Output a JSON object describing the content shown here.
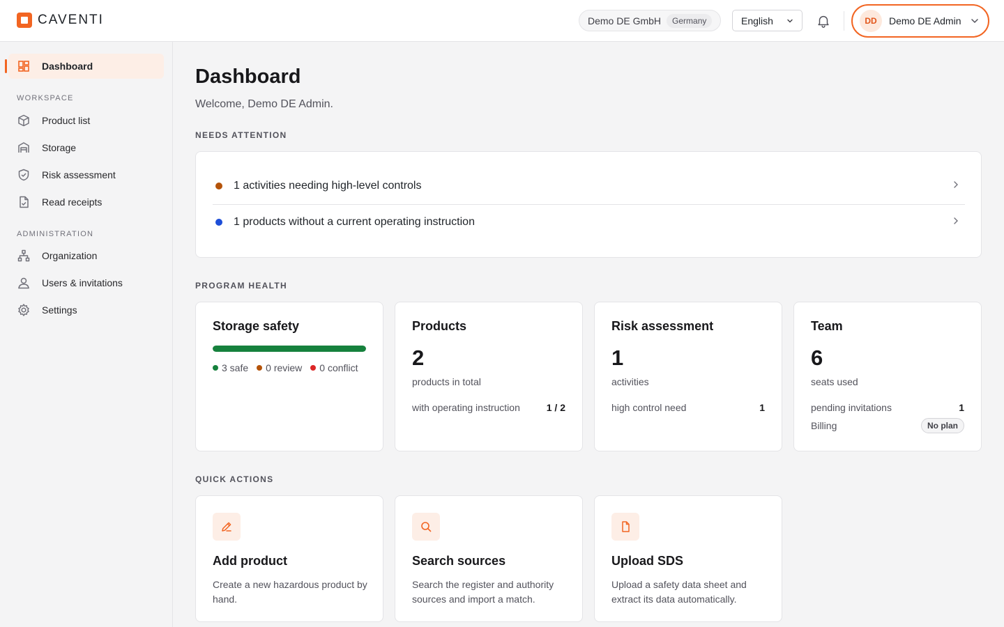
{
  "brand": {
    "name": "CAVENTI",
    "accent": "#f26522"
  },
  "header": {
    "org_name": "Demo DE GmbH",
    "org_country": "Germany",
    "language": "English",
    "user_initials": "DD",
    "user_name": "Demo DE Admin"
  },
  "sidebar": {
    "dashboard": "Dashboard",
    "workspace_label": "WORKSPACE",
    "workspace_items": [
      {
        "label": "Product list",
        "icon": "cube-icon"
      },
      {
        "label": "Storage",
        "icon": "warehouse-icon"
      },
      {
        "label": "Risk assessment",
        "icon": "shield-check-icon"
      },
      {
        "label": "Read receipts",
        "icon": "document-check-icon"
      }
    ],
    "admin_label": "ADMINISTRATION",
    "admin_items": [
      {
        "label": "Organization",
        "icon": "org-chart-icon"
      },
      {
        "label": "Users & invitations",
        "icon": "user-icon"
      },
      {
        "label": "Settings",
        "icon": "gear-icon"
      }
    ]
  },
  "main": {
    "title": "Dashboard",
    "welcome": "Welcome, Demo DE Admin.",
    "needs_attention_label": "NEEDS ATTENTION",
    "attention": [
      {
        "text": "1 activities needing high-level controls",
        "color": "#b45309"
      },
      {
        "text": "1 products without a current operating instruction",
        "color": "#1d4ed8"
      }
    ],
    "program_health_label": "PROGRAM HEALTH",
    "storage": {
      "title": "Storage safety",
      "safe_fraction": 1.0,
      "safe": "3 safe",
      "review": "0 review",
      "conflict": "0 conflict",
      "colors": {
        "safe": "#16813d",
        "review": "#b45309",
        "conflict": "#dc2626"
      }
    },
    "products": {
      "title": "Products",
      "count": "2",
      "sub": "products in total",
      "row_label": "with operating instruction",
      "row_value": "1 / 2"
    },
    "risk": {
      "title": "Risk assessment",
      "count": "1",
      "sub": "activities",
      "row_label": "high control need",
      "row_value": "1"
    },
    "team": {
      "title": "Team",
      "count": "6",
      "sub": "seats used",
      "row1_label": "pending invitations",
      "row1_value": "1",
      "row2_label": "Billing",
      "row2_badge": "No plan"
    },
    "quick_actions_label": "QUICK ACTIONS",
    "quick_actions": [
      {
        "title": "Add product",
        "desc": "Create a new hazardous product by hand.",
        "icon": "pencil-icon"
      },
      {
        "title": "Search sources",
        "desc": "Search the register and authority sources and import a match.",
        "icon": "search-icon"
      },
      {
        "title": "Upload SDS",
        "desc": "Upload a safety data sheet and extract its data automatically.",
        "icon": "file-icon"
      }
    ]
  }
}
